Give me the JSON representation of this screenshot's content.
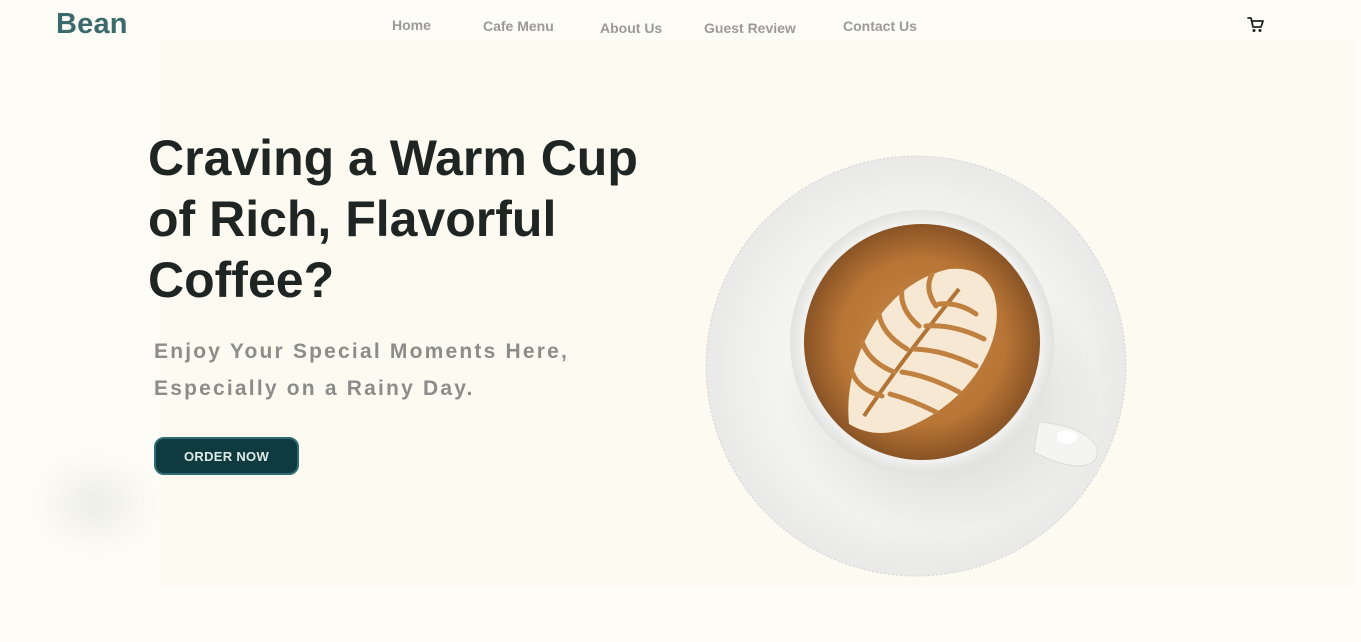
{
  "brand": {
    "logo_text": "Bean"
  },
  "nav": {
    "items": [
      {
        "label": "Home"
      },
      {
        "label": "Cafe Menu"
      },
      {
        "label": "About Us"
      },
      {
        "label": "Guest Review"
      },
      {
        "label": "Contact Us"
      }
    ],
    "cart_icon": "cart-icon"
  },
  "hero": {
    "headline_lines": [
      "Craving a Warm Cup",
      "of Rich, Flavorful",
      "Coffee?"
    ],
    "subline_lines": [
      "Enjoy Your Special Moments Here,",
      "Especially on a Rainy Day."
    ],
    "cta_label": "ORDER NOW",
    "image_icon": "latte-cup-icon"
  },
  "colors": {
    "background": "#fefcf6",
    "brand_teal": "#3a6b6a",
    "button_bg": "#0f3b40",
    "headline": "#1f2523",
    "subline": "#8c8c89",
    "nav_text": "#9a9a9a"
  }
}
